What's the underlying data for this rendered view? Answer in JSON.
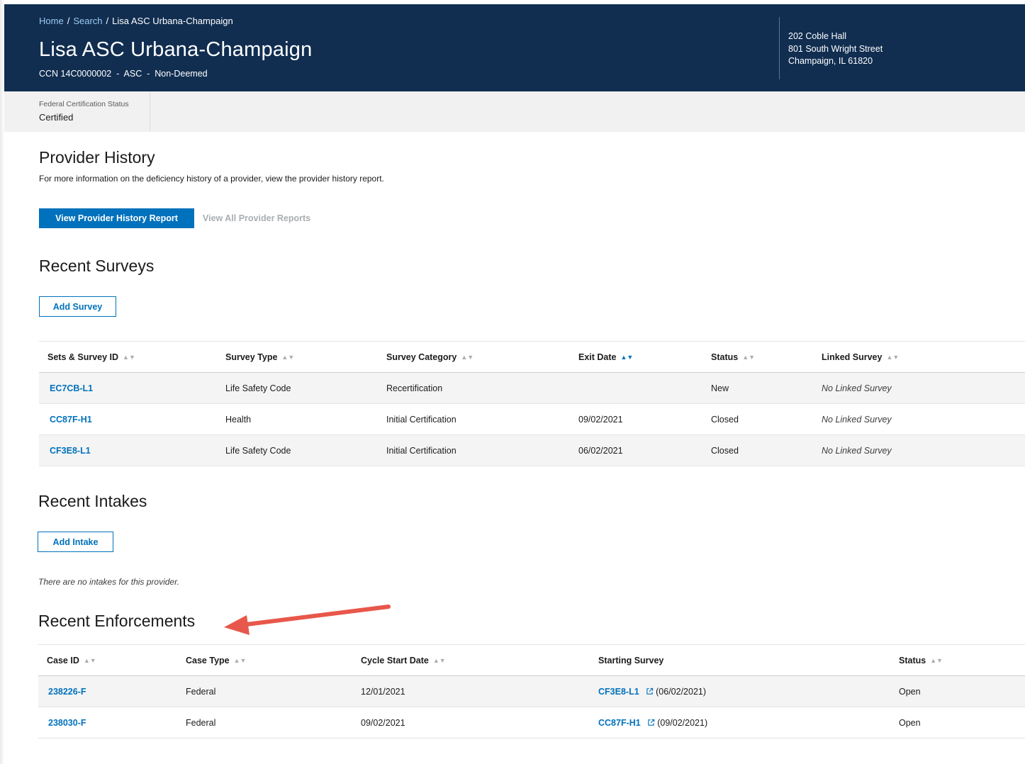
{
  "breadcrumb": {
    "home": "Home",
    "search": "Search",
    "current": "Lisa ASC Urbana-Champaign"
  },
  "header": {
    "title": "Lisa ASC Urbana-Champaign",
    "ccn_line": "CCN 14C0000002  -  ASC  -  Non-Deemed",
    "address": [
      "202 Coble Hall",
      "801 South Wright Street",
      "Champaign, IL 61820"
    ]
  },
  "status": {
    "label": "Federal Certification Status",
    "value": "Certified"
  },
  "provider_history": {
    "title": "Provider History",
    "description": "For more information on the deficiency history of a provider, view the provider history report.",
    "primary_button": "View Provider History Report",
    "secondary_link": "View All Provider Reports"
  },
  "surveys": {
    "title": "Recent Surveys",
    "add_button": "Add Survey",
    "columns": [
      "Sets & Survey ID",
      "Survey Type",
      "Survey Category",
      "Exit Date",
      "Status",
      "Linked Survey"
    ],
    "rows": [
      [
        "EC7CB-L1",
        "Life Safety Code",
        "Recertification",
        "",
        "New",
        "No Linked Survey"
      ],
      [
        "CC87F-H1",
        "Health",
        "Initial Certification",
        "09/02/2021",
        "Closed",
        "No Linked Survey"
      ],
      [
        "CF3E8-L1",
        "Life Safety Code",
        "Initial Certification",
        "06/02/2021",
        "Closed",
        "No Linked Survey"
      ]
    ]
  },
  "intakes": {
    "title": "Recent Intakes",
    "add_button": "Add Intake",
    "empty_message": "There are no intakes for this provider."
  },
  "enforcements": {
    "title": "Recent Enforcements",
    "columns": [
      "Case ID",
      "Case Type",
      "Cycle Start Date",
      "Starting Survey",
      "Status"
    ],
    "rows": [
      [
        "238226-F",
        "Federal",
        "12/01/2021",
        "CF3E8-L1",
        "(06/02/2021)",
        "Open"
      ],
      [
        "238030-F",
        "Federal",
        "09/02/2021",
        "CC87F-H1",
        "(09/02/2021)",
        "Open"
      ]
    ]
  },
  "colors": {
    "header_bg": "#112e51",
    "primary": "#0071bc",
    "annotation_arrow": "#e8574b"
  }
}
